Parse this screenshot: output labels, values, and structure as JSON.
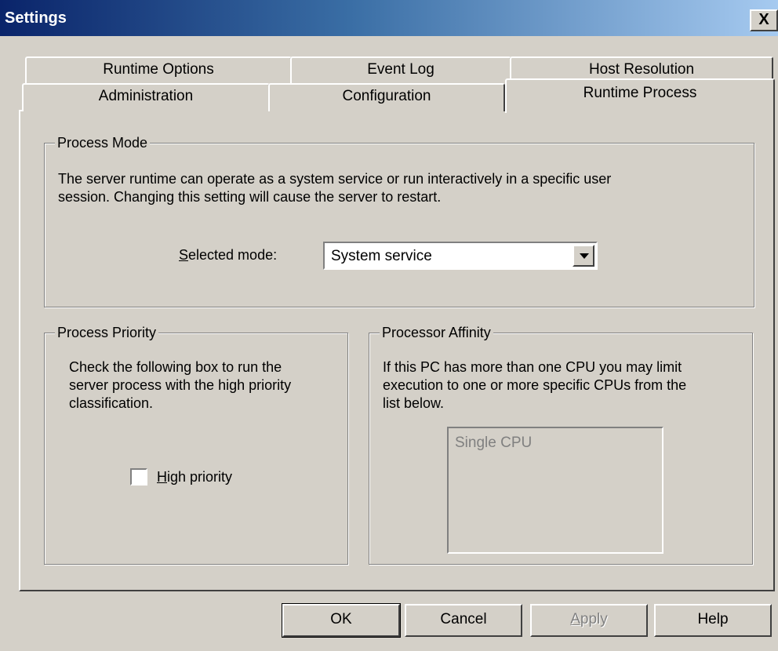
{
  "window": {
    "title": "Settings",
    "close_label": "X"
  },
  "tabs": {
    "back_row": [
      "Runtime Options",
      "Event Log",
      "Host Resolution"
    ],
    "front_row": [
      "Administration",
      "Configuration",
      "Runtime Process"
    ],
    "selected": "Runtime Process"
  },
  "process_mode": {
    "legend": "Process Mode",
    "description_line1": "The server runtime can operate as a system service or run interactively in a specific user",
    "description_line2": "session.  Changing this setting will cause the server to restart.",
    "selected_mode_label_rest": "elected mode:",
    "selected_mode_mnemonic": "S",
    "selected_mode_value": "System service"
  },
  "process_priority": {
    "legend": "Process Priority",
    "description_line1": "Check the following box to run the",
    "description_line2": "server process with the high priority",
    "description_line3": "classification.",
    "checkbox_mnemonic": "H",
    "checkbox_label_rest": "igh priority",
    "checked": false
  },
  "processor_affinity": {
    "legend": "Processor Affinity",
    "description_line1": "If this PC has more than one CPU you may limit",
    "description_line2": "execution to one or more specific CPUs from the",
    "description_line3": "list below.",
    "list_items": [
      "Single CPU"
    ]
  },
  "buttons": {
    "ok": "OK",
    "cancel": "Cancel",
    "apply_mnemonic": "A",
    "apply_rest": "pply",
    "help": "Help"
  },
  "colors": {
    "face": "#d4d0c8",
    "titlebar_start": "#0a246a",
    "titlebar_end": "#a6caf0",
    "disabled_text": "#808080"
  }
}
